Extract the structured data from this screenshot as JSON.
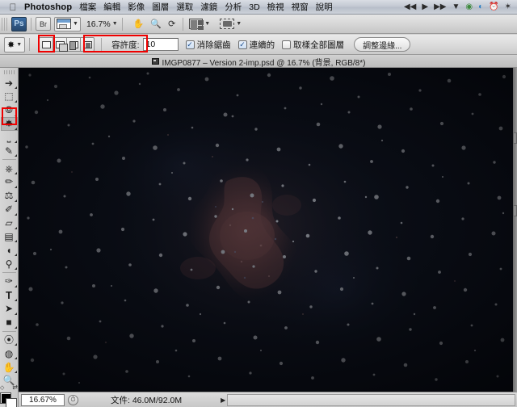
{
  "menubar": {
    "apple_icon": "apple-logo",
    "app_name": "Photoshop",
    "items": [
      "檔案",
      "編輯",
      "影像",
      "圖層",
      "選取",
      "濾鏡",
      "分析",
      "3D",
      "檢視",
      "視窗",
      "說明"
    ],
    "status_icons": [
      "rewind-icon",
      "play-icon",
      "fast-forward-icon",
      "chevron-down-icon",
      "airport-icon",
      "wifi-icon",
      "time-machine-icon",
      "bluetooth-icon"
    ]
  },
  "appbar": {
    "ps_badge": "Ps",
    "bridge_label": "Br",
    "screen_mode": "screen-mode-selector",
    "zoom_level": "16.7%",
    "hand_icon": "hand-icon",
    "zoom_icon": "magnifier-icon",
    "rotate_icon": "rotate-view-icon",
    "arrange_documents": "arrange-documents-icon",
    "screen_mode_icon": "screen-mode-icon"
  },
  "optionsbar": {
    "tool_icon": "magic-wand-icon",
    "selection_modes": [
      "new-selection",
      "add-to-selection",
      "subtract-from-selection",
      "intersect-selection"
    ],
    "active_selection_mode": 1,
    "tolerance_label": "容許度:",
    "tolerance_value": "10",
    "checkboxes": [
      {
        "label": "消除鋸齒",
        "checked": true
      },
      {
        "label": "連續的",
        "checked": true
      },
      {
        "label": "取樣全部圖層",
        "checked": false
      }
    ],
    "refine_edge_button": "調整邊緣..."
  },
  "annotations": {
    "accent_color": "#ef0000",
    "boxes": [
      "add-to-selection-mode",
      "tolerance-field",
      "magic-wand-tool"
    ]
  },
  "document": {
    "tab_title": "IMGP0877 – Version 2-imp.psd @ 16.7% (背景, RGB/8*)",
    "tab_icon": "document-icon"
  },
  "tools": {
    "items": [
      {
        "name": "move-tool",
        "glyph": "↖",
        "selected": false,
        "more": true
      },
      {
        "name": "rectangular-marquee-tool",
        "glyph": "⬚",
        "selected": false,
        "more": true
      },
      {
        "name": "lasso-tool",
        "glyph": "❦",
        "selected": false,
        "more": true
      },
      {
        "name": "magic-wand-tool",
        "glyph": "✧",
        "selected": true,
        "more": true
      },
      {
        "name": "crop-tool",
        "glyph": "⌗",
        "selected": false,
        "more": true
      },
      {
        "name": "eyedropper-tool",
        "glyph": "✎",
        "selected": false,
        "more": true
      },
      {
        "name": "spot-healing-brush-tool",
        "glyph": "✒",
        "selected": false,
        "more": true
      },
      {
        "name": "brush-tool",
        "glyph": "✏",
        "selected": false,
        "more": true
      },
      {
        "name": "clone-stamp-tool",
        "glyph": "⚖",
        "selected": false,
        "more": true
      },
      {
        "name": "history-brush-tool",
        "glyph": "✐",
        "selected": false,
        "more": true
      },
      {
        "name": "eraser-tool",
        "glyph": "▱",
        "selected": false,
        "more": true
      },
      {
        "name": "gradient-tool",
        "glyph": "▤",
        "selected": false,
        "more": true
      },
      {
        "name": "blur-tool",
        "glyph": "◖",
        "selected": false,
        "more": true
      },
      {
        "name": "dodge-tool",
        "glyph": "⚲",
        "selected": false,
        "more": true
      },
      {
        "name": "pen-tool",
        "glyph": "✑",
        "selected": false,
        "more": true
      },
      {
        "name": "horizontal-type-tool",
        "glyph": "T",
        "selected": false,
        "more": true
      },
      {
        "name": "path-selection-tool",
        "glyph": "➤",
        "selected": false,
        "more": true
      },
      {
        "name": "rectangle-shape-tool",
        "glyph": "■",
        "selected": false,
        "more": true
      },
      {
        "name": "3d-rotate-tool",
        "glyph": "⦿",
        "selected": false,
        "more": true
      },
      {
        "name": "3d-orbit-tool",
        "glyph": "◎",
        "selected": false,
        "more": true
      },
      {
        "name": "hand-tool",
        "glyph": "✋",
        "selected": false,
        "more": true
      },
      {
        "name": "zoom-tool",
        "glyph": "⚲",
        "selected": false,
        "more": false
      }
    ],
    "foreground_color": "#000000",
    "background_color": "#ffffff"
  },
  "statusbar": {
    "zoom_value": "16.67%",
    "clock_icon": "clock-icon",
    "doc_info": "文件: 46.0M/92.0M",
    "expand_icon": "play-arrow-icon"
  },
  "image": {
    "subject": "starfield-with-red-emission-nebula",
    "background_color": "#05070c",
    "nebula_color": "#8a4a42"
  }
}
